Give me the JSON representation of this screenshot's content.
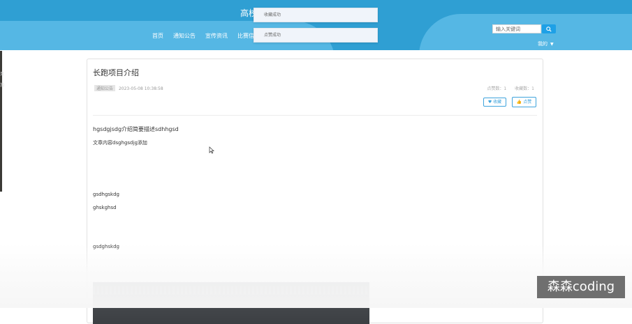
{
  "header": {
    "site_title": "高校",
    "nav": [
      "首页",
      "通知公告",
      "宣传资讯",
      "比赛信息"
    ],
    "search_placeholder": "输入关键词",
    "my_menu": "我的"
  },
  "toasts": [
    "收藏成功",
    "点赞成功"
  ],
  "left_edge": [
    "页",
    "加"
  ],
  "article": {
    "title": "长跑项目介绍",
    "category_badge": "通知公告",
    "date": "2023-05-08 10:38:58",
    "views": "点赞数：1",
    "favorites": "收藏数：1",
    "fav_label": "收藏",
    "like_label": "点赞",
    "lead": "hgsdgjsdg介绍简要描述sdhhgsd",
    "paragraphs": [
      "文章内容dsghgsdjg添加",
      "gsdhgskdg",
      "ghskghsd",
      "gsdghskdg"
    ]
  },
  "watermark": "森森coding",
  "colors": {
    "header_blue": "#2f9fd3",
    "header_wave": "#55b7e4",
    "accent": "#3ea3dc"
  }
}
